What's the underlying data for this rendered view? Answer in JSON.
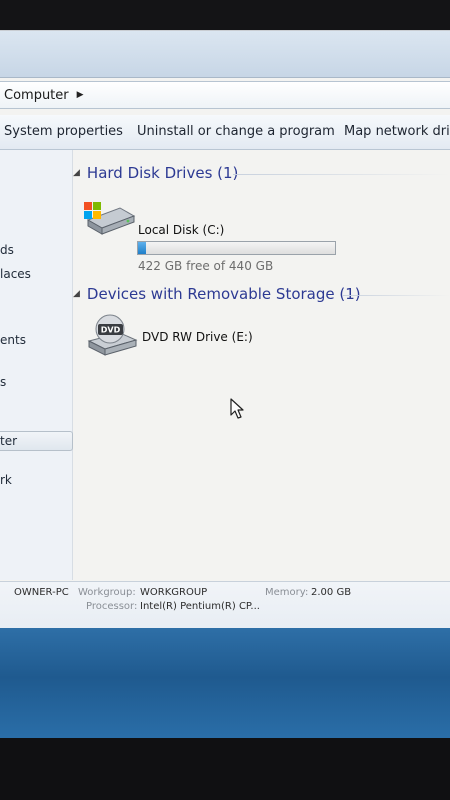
{
  "breadcrumb": {
    "items": [
      "Computer"
    ]
  },
  "toolbar": {
    "items": [
      "System properties",
      "Uninstall or change a program",
      "Map network drive"
    ]
  },
  "nav_pane": {
    "items": [
      "ds",
      "laces",
      "ents",
      "s",
      "ter",
      "rk"
    ]
  },
  "groups": {
    "hard_disks": {
      "header": "Hard Disk Drives (1)",
      "drive": {
        "name": "Local Disk (C:)",
        "free_text": "422 GB free of 440 GB",
        "used_fraction": 0.041,
        "icon": "windows-hard-drive-icon"
      }
    },
    "removable": {
      "header": "Devices with Removable Storage (1)",
      "drive": {
        "name": "DVD RW Drive (E:)",
        "icon_label": "DVD",
        "icon": "dvd-drive-icon"
      }
    }
  },
  "details": {
    "computer_name": "OWNER-PC",
    "workgroup_label": "Workgroup:",
    "workgroup_value": "WORKGROUP",
    "memory_label": "Memory:",
    "memory_value": "2.00 GB",
    "processor_label": "Processor:",
    "processor_value": "Intel(R) Pentium(R) CP..."
  },
  "colors": {
    "group_header": "#2d3a93",
    "bar_fill": "#1f7fc9",
    "taskbar": "#1f5a8f"
  }
}
